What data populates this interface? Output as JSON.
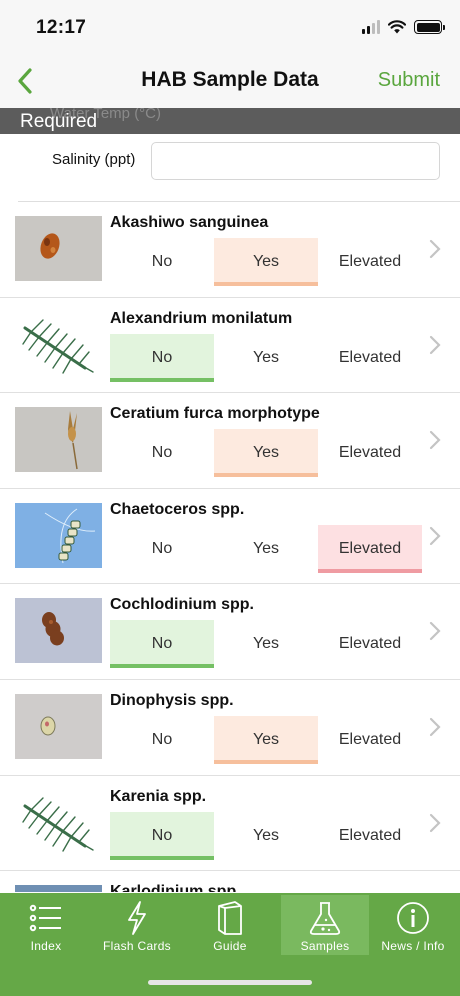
{
  "status": {
    "time": "12:17"
  },
  "nav": {
    "title": "HAB Sample Data",
    "submit_label": "Submit"
  },
  "required": {
    "label": "Required",
    "ghost_text": "Water Temp (°C)"
  },
  "salinity": {
    "label": "Salinity (ppt)",
    "value": ""
  },
  "options": {
    "no": "No",
    "yes": "Yes",
    "elevated": "Elevated"
  },
  "species": [
    {
      "name": "Akashiwo sanguinea",
      "selected": "yes",
      "icon": "microscope-photo"
    },
    {
      "name": "Alexandrium monilatum",
      "selected": "no",
      "icon": "chain-illustration"
    },
    {
      "name": "Ceratium furca morphotype",
      "selected": "yes",
      "icon": "microscope-photo"
    },
    {
      "name": "Chaetoceros spp.",
      "selected": "elevated",
      "icon": "microscope-photo"
    },
    {
      "name": "Cochlodinium spp.",
      "selected": "no",
      "icon": "microscope-photo"
    },
    {
      "name": "Dinophysis spp.",
      "selected": "yes",
      "icon": "microscope-photo"
    },
    {
      "name": "Karenia spp.",
      "selected": "no",
      "icon": "chain-illustration"
    },
    {
      "name": "Karlodinium spp.",
      "selected": "",
      "icon": "microscope-photo"
    }
  ],
  "tabs": [
    {
      "label": "Index",
      "icon": "list-icon",
      "active": false
    },
    {
      "label": "Flash Cards",
      "icon": "lightning-icon",
      "active": false
    },
    {
      "label": "Guide",
      "icon": "book-icon",
      "active": false
    },
    {
      "label": "Samples",
      "icon": "flask-icon",
      "active": true
    },
    {
      "label": "News / Info",
      "icon": "info-icon",
      "active": false
    }
  ],
  "colors": {
    "accent_green": "#5aa63e",
    "tab_bar": "#65a847",
    "no_selected": "#e2f4dd",
    "yes_selected": "#fdeadf",
    "elevated_selected": "#fde0e2"
  }
}
